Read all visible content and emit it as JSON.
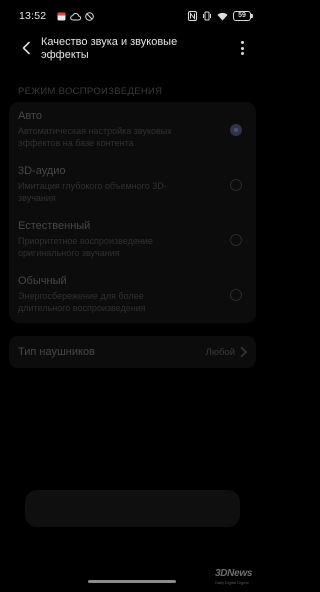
{
  "status_bar": {
    "time": "13:52",
    "battery": "59",
    "left_icons": [
      "calendar-icon",
      "cloud-icon",
      "do-not-disturb-icon"
    ],
    "right_icons": [
      "nfc-icon",
      "vibrate-icon",
      "wifi-icon",
      "battery-icon"
    ]
  },
  "header": {
    "title": "Качество звука и звуковые эффекты",
    "back_icon": "back-arrow-icon",
    "more_icon": "more-vertical-icon"
  },
  "playback_section": {
    "title": "РЕЖИМ ВОСПРОИЗВЕДЕНИЯ",
    "modes": [
      {
        "label": "Авто",
        "description": "Автоматическая настройка звуковых эффектов на базе контента",
        "selected": true
      },
      {
        "label": "3D-аудио",
        "description": "Имитация глубокого объемного 3D-звучания",
        "selected": false
      },
      {
        "label": "Естественный",
        "description": "Приоритетное воспроизведение оригинального звучания",
        "selected": false
      },
      {
        "label": "Обычный",
        "description": "Энергосбережение для более длительного воспроизведения",
        "selected": false
      }
    ]
  },
  "headphones": {
    "label": "Тип наушников",
    "value": "Любой"
  },
  "watermark": {
    "logo": "3DNews",
    "tagline": "Daily Digital Digest"
  },
  "colors": {
    "background": "#000000",
    "card": "#0c0c0c",
    "accent": "#4a5372"
  }
}
